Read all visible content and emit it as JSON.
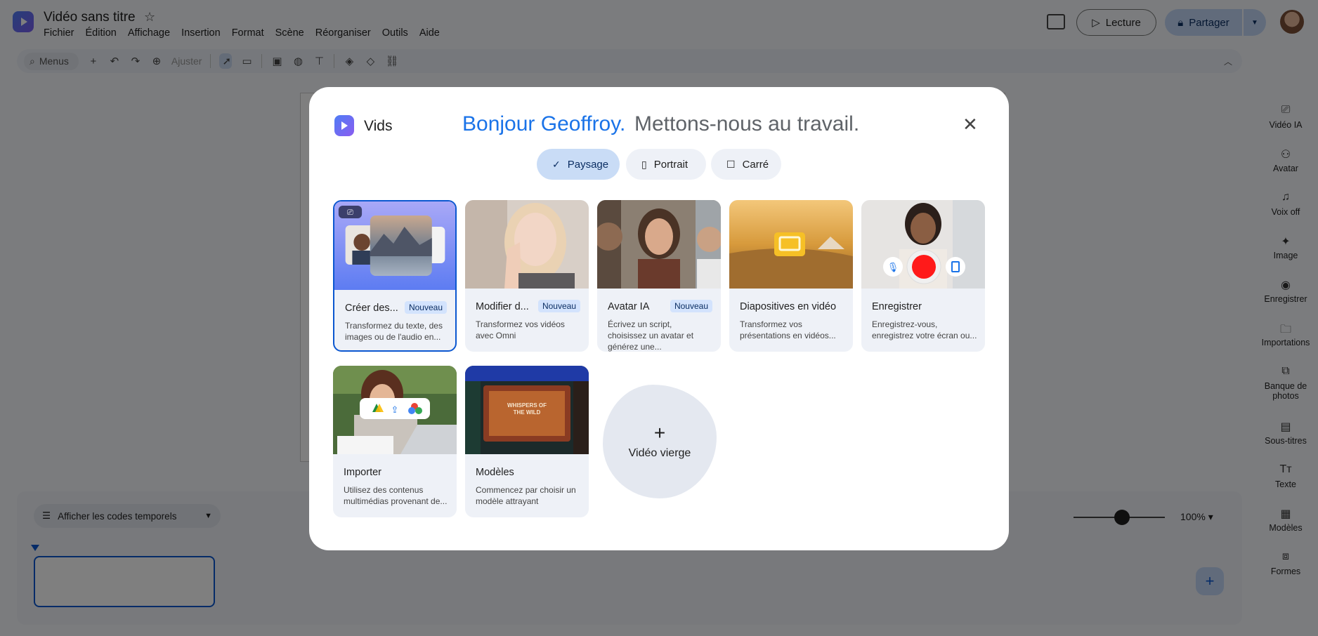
{
  "app": {
    "title": "Vidéo sans titre",
    "menu": [
      "Fichier",
      "Édition",
      "Affichage",
      "Insertion",
      "Format",
      "Scène",
      "Réorganiser",
      "Outils",
      "Aide"
    ],
    "lecture": "Lecture",
    "share": "Partager"
  },
  "toolbar": {
    "search": "Menus",
    "fit": "Ajuster"
  },
  "right_panel": {
    "items": [
      "Vidéo IA",
      "Avatar",
      "Voix off",
      "Image",
      "Enregistrer",
      "Importations",
      "Banque de photos",
      "Sous-titres",
      "Texte",
      "Modèles",
      "Formes"
    ]
  },
  "timeline": {
    "toggle": "Afficher les codes temporels",
    "zoom": "100%",
    "zoom_level": 0.5
  },
  "modal": {
    "brand": "Vids",
    "greeting_name": "Bonjour Geoffroy.",
    "greeting_rest": "Mettons-nous au travail.",
    "formats": [
      "Paysage",
      "Portrait",
      "Carré"
    ],
    "selected_format": "Paysage",
    "cards": [
      {
        "title": "Créer des...",
        "badge": "Nouveau",
        "desc": "Transformez du texte, des images ou de l'audio en..."
      },
      {
        "title": "Modifier d...",
        "badge": "Nouveau",
        "desc": "Transformez vos vidéos avec Omni"
      },
      {
        "title": "Avatar IA",
        "badge": "Nouveau",
        "desc": "Écrivez un script, choisissez un avatar et générez une..."
      },
      {
        "title": "Diapositives en vidéo",
        "badge": "",
        "desc": "Transformez vos présentations en vidéos..."
      },
      {
        "title": "Enregistrer",
        "badge": "",
        "desc": "Enregistrez-vous, enregistrez votre écran ou..."
      },
      {
        "title": "Importer",
        "badge": "",
        "desc": "Utilisez des contenus multimédias provenant de..."
      },
      {
        "title": "Modèles",
        "badge": "",
        "desc": "Commencez par choisir un modèle attrayant"
      }
    ],
    "template_thumb_text": "WHISPERS OF THE WILD",
    "blank": "Vidéo vierge"
  },
  "colors": {
    "accent": "#0b57d0",
    "greeting": "#1a73e8",
    "record": "#ff1a1a"
  }
}
